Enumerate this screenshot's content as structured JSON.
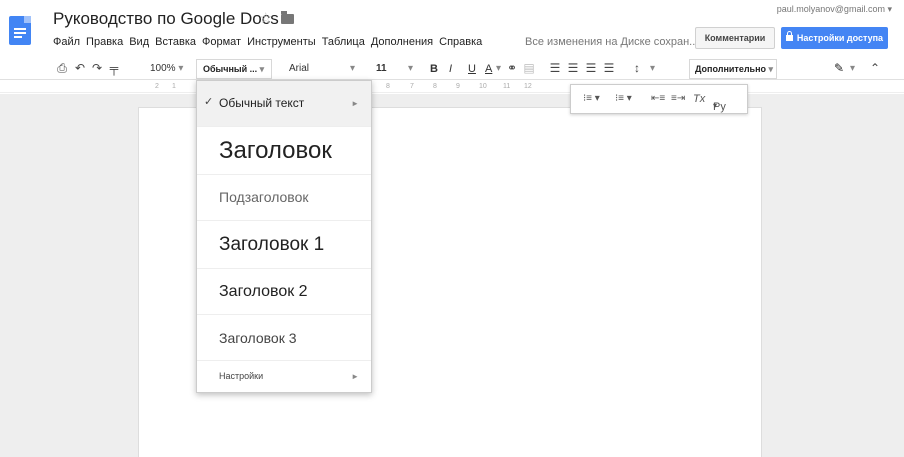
{
  "header": {
    "title": "Руководство по Google Docs",
    "account_email": "paul.molyanov@gmail.com",
    "save_status": "Все изменения на Диске сохран...",
    "comments_label": "Комментарии",
    "share_label": "Настройки доступа"
  },
  "menu": [
    "Файл",
    "Правка",
    "Вид",
    "Вставка",
    "Формат",
    "Инструменты",
    "Таблица",
    "Дополнения",
    "Справка"
  ],
  "toolbar": {
    "zoom": "100%",
    "style": "Обычный ...",
    "font": "Arial",
    "size": "11",
    "bold": "B",
    "italic": "I",
    "underline": "U",
    "text_color": "A",
    "more": "Дополнительно",
    "clear_format": "Tx",
    "spellcheck": "Ру"
  },
  "ruler_marks": [
    "2",
    "1",
    "8",
    "7",
    "8",
    "9",
    "10",
    "11",
    "12"
  ],
  "styles_menu": {
    "items": [
      {
        "label": "Обычный текст",
        "checked": true,
        "has_submenu": true
      },
      {
        "label": "Заголовок"
      },
      {
        "label": "Подзаголовок"
      },
      {
        "label": "Заголовок 1"
      },
      {
        "label": "Заголовок 2"
      },
      {
        "label": "Заголовок 3"
      }
    ],
    "settings_label": "Настройки"
  },
  "colors": {
    "brand_blue": "#4285f4",
    "share_button": "#4485f4"
  },
  "icons": [
    "docs-logo-icon",
    "star-icon",
    "folder-icon",
    "print-icon",
    "undo-icon",
    "redo-icon",
    "paint-format-icon",
    "link-icon",
    "comment-icon",
    "align-left-icon",
    "align-center-icon",
    "align-right-icon",
    "align-justify-icon",
    "line-spacing-icon",
    "pencil-icon",
    "collapse-icon",
    "numbered-list-icon",
    "bulleted-list-icon",
    "indent-decrease-icon",
    "indent-increase-icon",
    "lock-icon",
    "checkmark-icon",
    "submenu-arrow-icon"
  ]
}
